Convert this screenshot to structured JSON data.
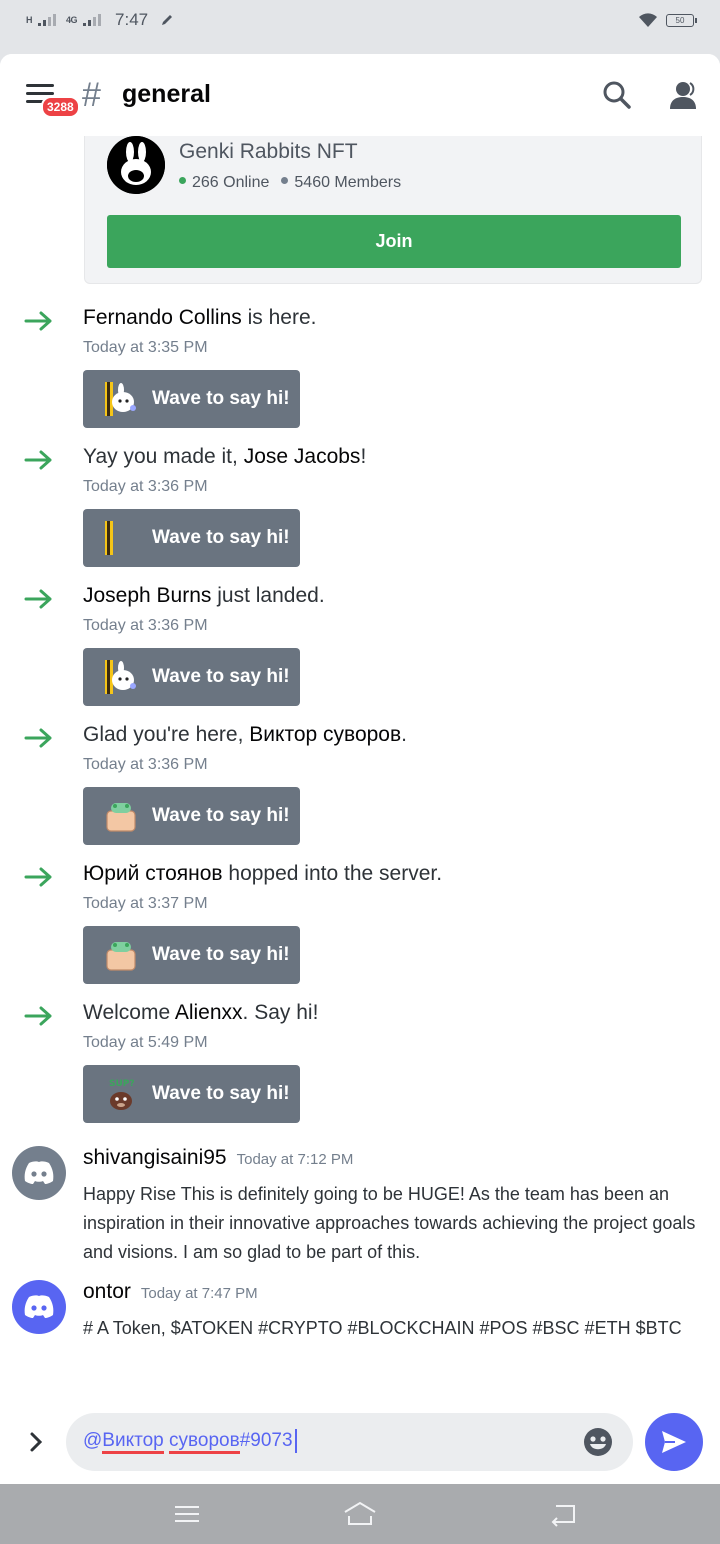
{
  "status_bar": {
    "net1": "H",
    "net2": "4G",
    "time": "7:47",
    "battery": "50"
  },
  "header": {
    "notification_count": "3288",
    "channel_hash": "#",
    "channel_name": "general"
  },
  "invite": {
    "server_name": "Genki Rabbits NFT",
    "online": "266 Online",
    "members": "5460 Members",
    "online_color": "#3ba55c",
    "members_color": "#747f8d",
    "join_label": "Join"
  },
  "wave_label": "Wave to say hi!",
  "join_messages": [
    {
      "pre": "",
      "user": "Fernando Collins",
      "post": " is here.",
      "time": "Today at 3:35 PM",
      "sticker": "rabbit-peek"
    },
    {
      "pre": "Yay you made it, ",
      "user": "Jose Jacobs",
      "post": "!",
      "time": "Today at 3:36 PM",
      "sticker": "door-bar"
    },
    {
      "pre": "",
      "user": "Joseph Burns",
      "post": " just landed.",
      "time": "Today at 3:36 PM",
      "sticker": "rabbit-peek"
    },
    {
      "pre": "Glad you're here, ",
      "user": "Виктор суворов",
      "post": ".",
      "time": "Today at 3:36 PM",
      "sticker": "waving-hand"
    },
    {
      "pre": "",
      "user": "Юрий стоянов",
      "post": " hopped into the server.",
      "time": "Today at 3:37 PM",
      "sticker": "waving-hand"
    },
    {
      "pre": "Welcome ",
      "user": "Alienxx",
      "post": ". Say hi!",
      "time": "Today at 5:49 PM",
      "sticker": "sup-bear"
    }
  ],
  "messages": [
    {
      "author": "shivangisaini95",
      "time": "Today at 7:12 PM",
      "text": "Happy Rise This is definitely going to be HUGE! As the team has been an inspiration in their innovative approaches towards achieving the project goals and visions. I am so glad to be part of this.",
      "avatar_color": "#747f8d"
    },
    {
      "author": "ontor",
      "time": "Today at 7:47 PM",
      "text": "# A Token, $ATOKEN  #CRYPTO #BLOCKCHAIN #POS #BSC #ETH $BTC",
      "avatar_color": "#5865f2"
    }
  ],
  "composer": {
    "at": "@",
    "word1": "Виктор",
    "space": " ",
    "word2": "суворов",
    "tag": "#9073"
  },
  "colors": {
    "accent": "#5865f2",
    "join_green": "#3ba55c",
    "arrow_green": "#3ba55c",
    "wave_button": "#6a7480",
    "badge_red": "#ed4245"
  }
}
